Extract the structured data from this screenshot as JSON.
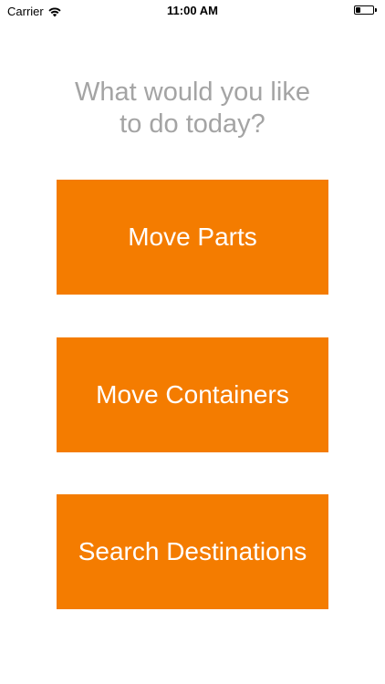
{
  "status_bar": {
    "carrier": "Carrier",
    "time": "11:00 AM",
    "battery_level": 0.3
  },
  "prompt": "What would you like\nto do today?",
  "buttons": [
    {
      "label": "Move Parts"
    },
    {
      "label": "Move Containers"
    },
    {
      "label": "Search Destinations"
    }
  ],
  "colors": {
    "accent": "#f47c00",
    "prompt_text": "#a4a4a4",
    "button_text": "#ffffff"
  }
}
